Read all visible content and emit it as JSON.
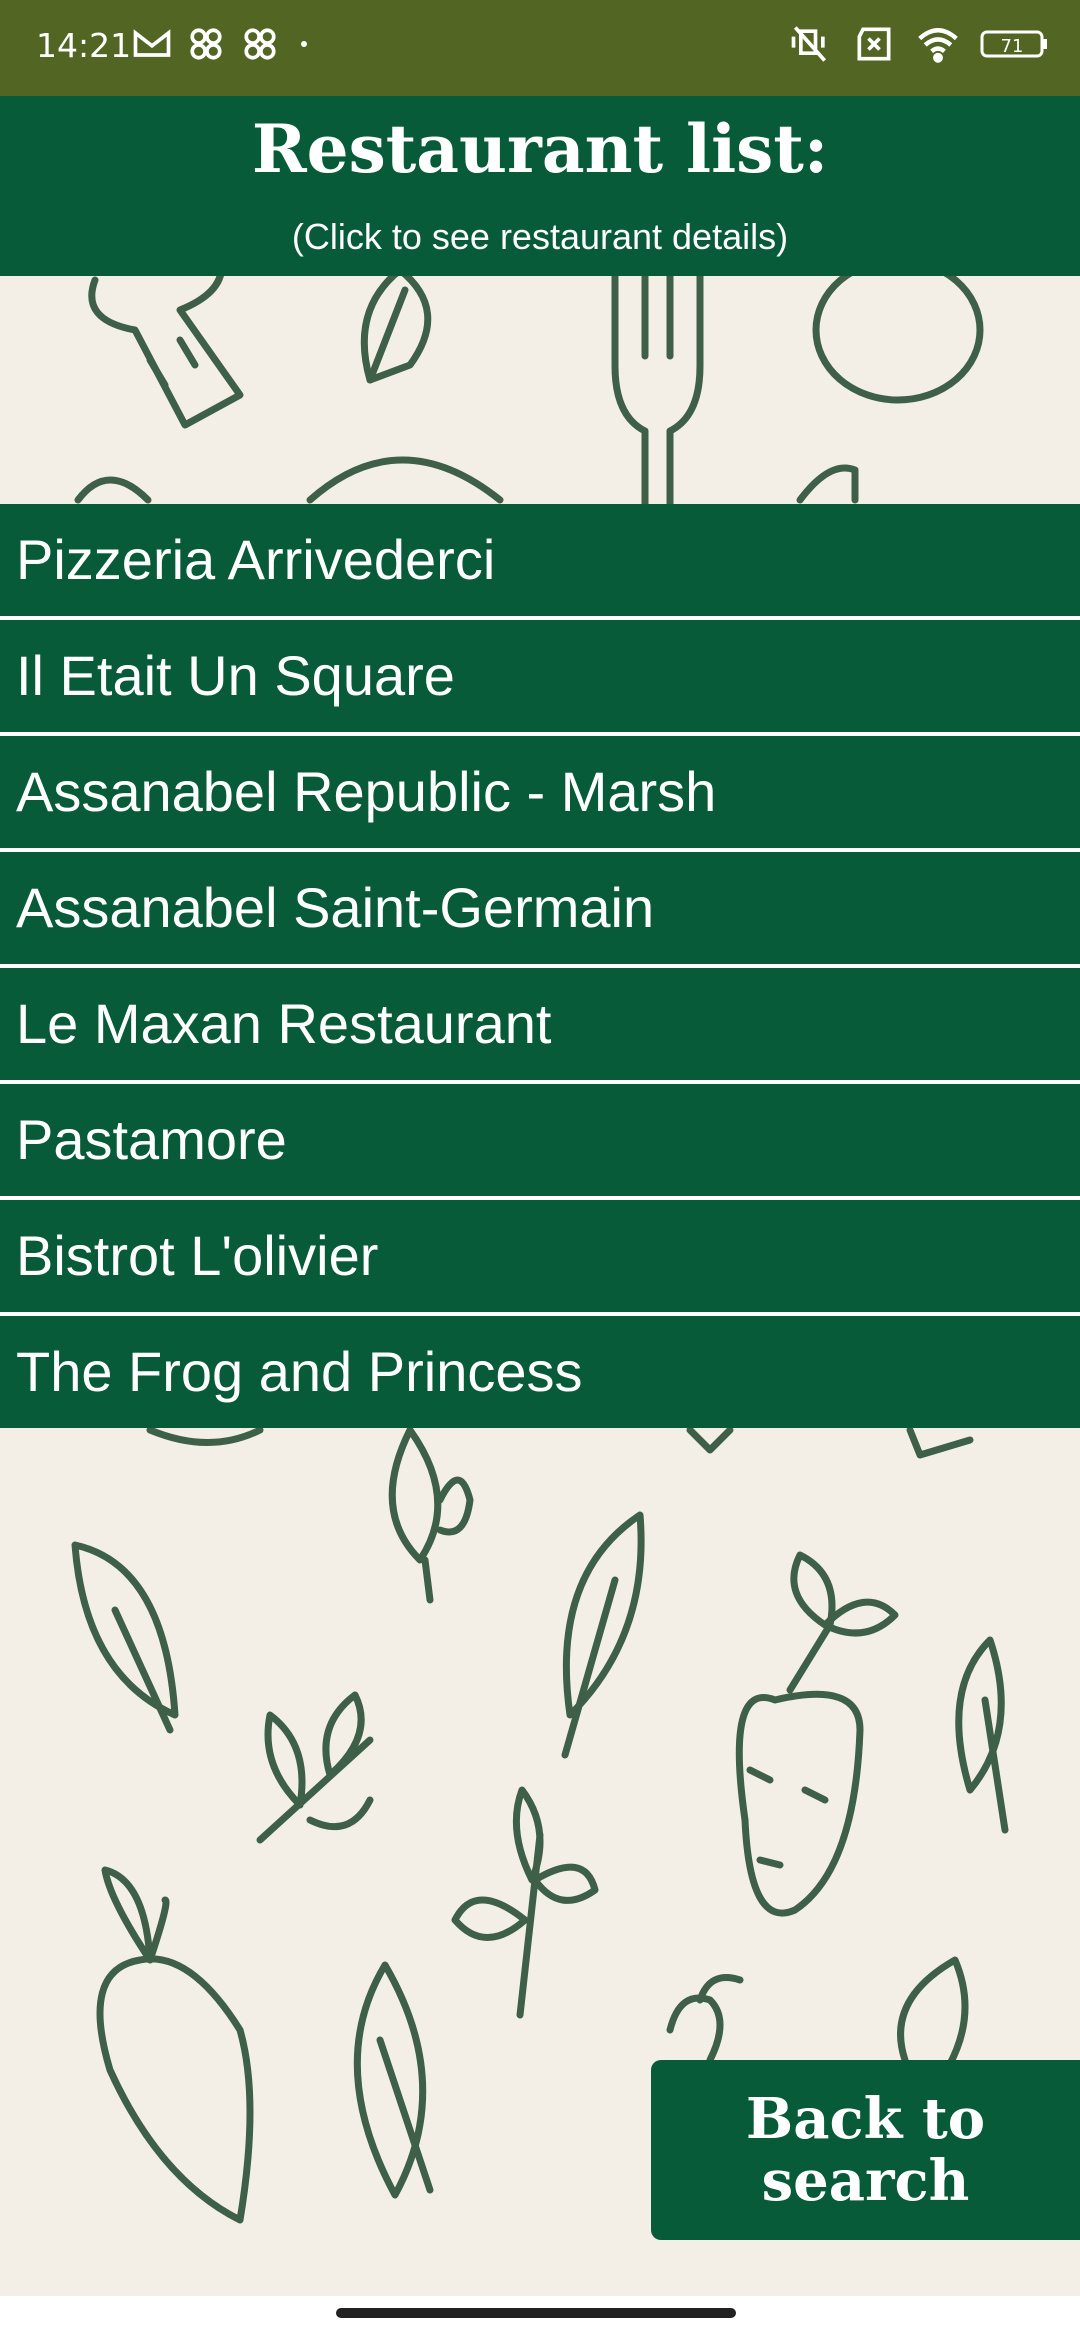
{
  "status_bar": {
    "time": "14:21",
    "left_icons": [
      "gmail-icon",
      "pinwheel-icon",
      "pinwheel-icon",
      "dot-icon"
    ],
    "right_icons": [
      "vibrate-off-icon",
      "no-sim-icon",
      "wifi-icon",
      "battery-icon"
    ],
    "battery_level": "71"
  },
  "header": {
    "title": "Restaurant list:",
    "subtitle": "(Click to see restaurant details)"
  },
  "restaurants": [
    "Pizzeria Arrivederci",
    "Il Etait Un Square",
    "Assanabel Republic - Marsh",
    "Assanabel Saint-Germain",
    "Le Maxan Restaurant",
    "Pastamore",
    "Bistrot L'olivier",
    "The Frog and Princess"
  ],
  "back_button": {
    "line1": "Back to",
    "line2": "search"
  },
  "colors": {
    "status_bar": "#536523",
    "primary_green": "#075b38",
    "background": "#f4efe6",
    "doodle": "#3f6048"
  }
}
